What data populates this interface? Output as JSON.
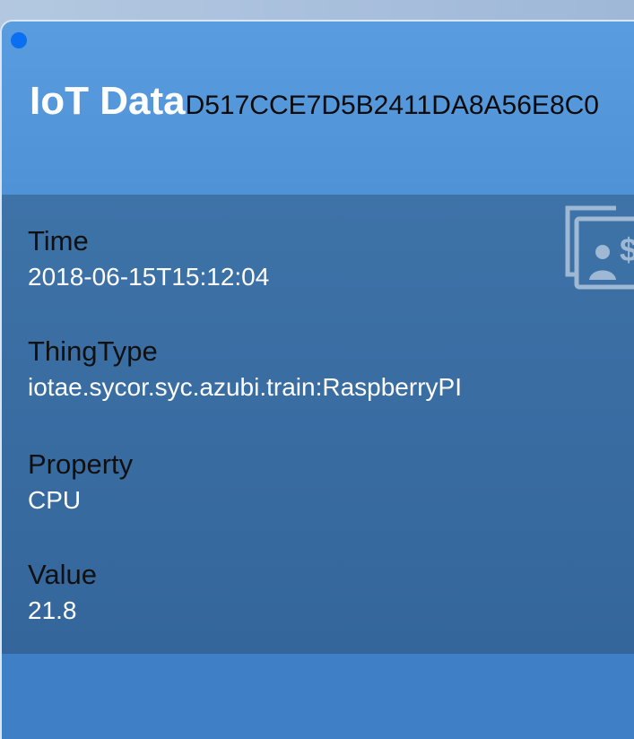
{
  "tile": {
    "title": "IoT Data",
    "device_id": "D517CCE7D5B2411DA8A56E8C0",
    "colors": {
      "header": "#5a9ce0",
      "body": "#3a6ea3",
      "status_dot": "#0a6ff0"
    },
    "icon": "document-person-dollar-icon",
    "fields": [
      {
        "label": "Time",
        "value": "2018-06-15T15:12:04"
      },
      {
        "label": "ThingType",
        "value": "iotae.sycor.syc.azubi.train:RaspberryPI"
      },
      {
        "label": "Property",
        "value": "CPU"
      },
      {
        "label": "Value",
        "value": "21.8"
      }
    ]
  }
}
